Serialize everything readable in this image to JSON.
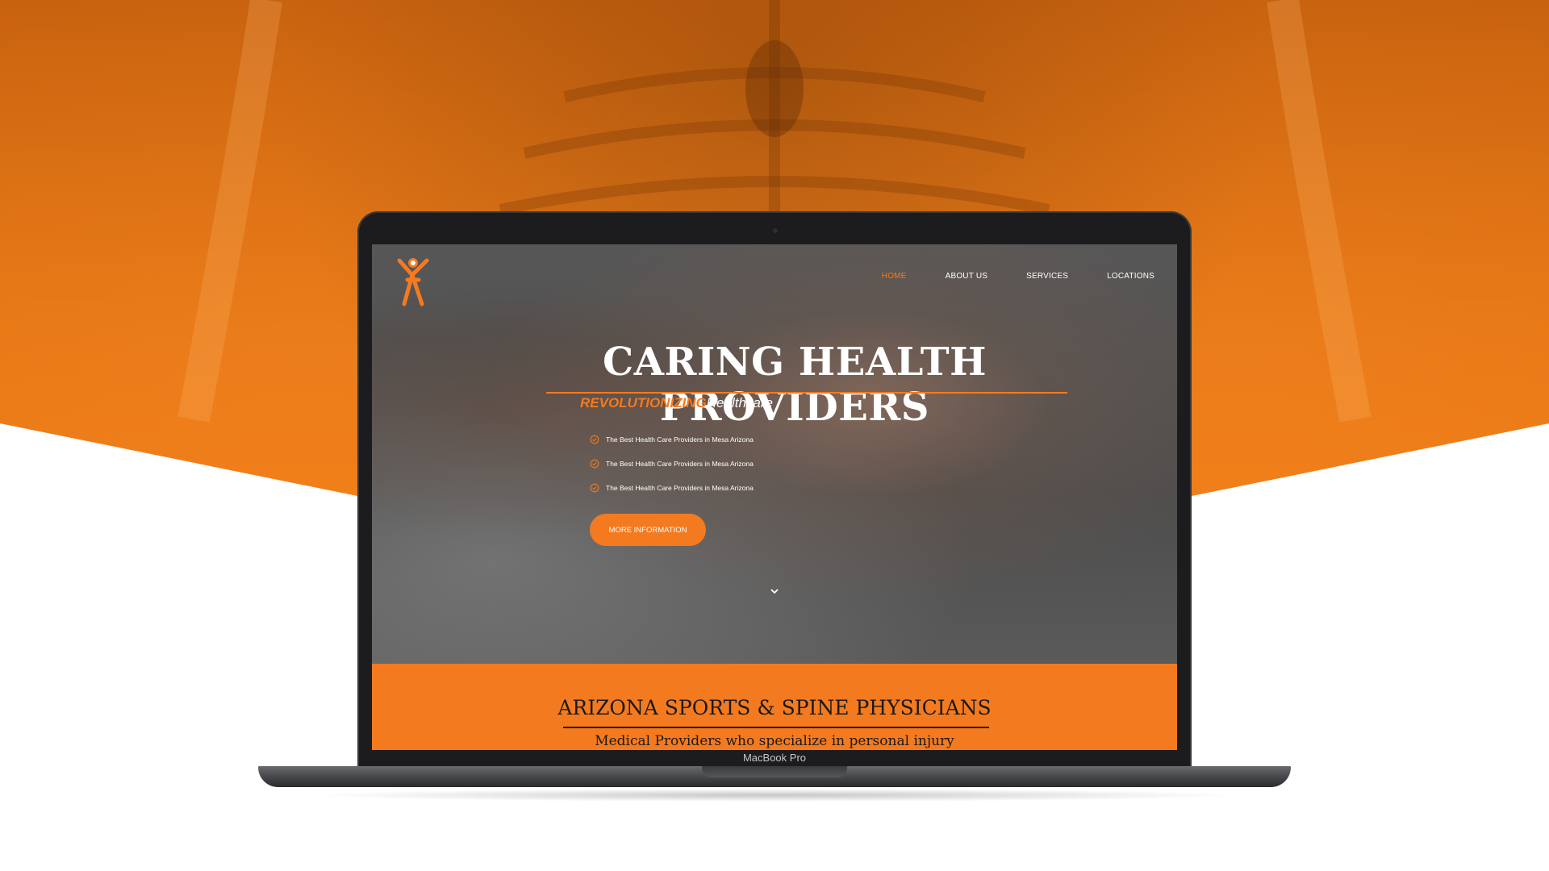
{
  "website": {
    "nav": {
      "items": [
        {
          "label": "HOME",
          "active": true
        },
        {
          "label": "ABOUT US",
          "active": false
        },
        {
          "label": "SERVICES",
          "active": false
        },
        {
          "label": "LOCATIONS",
          "active": false
        }
      ]
    },
    "hero": {
      "title": "CARING HEALTH PROVIDERS",
      "tagline_accent": "REVOLUTIONIZING",
      "tagline_rest": "Healthcare",
      "checklist": [
        "The Best Health Care Providers in Mesa Arizona",
        "The Best Health Care Providers in Mesa Arizona",
        "The Best Health Care Providers in Mesa Arizona"
      ],
      "cta_label": "MORE INFORMATION"
    },
    "section": {
      "title": "ARIZONA SPORTS & SPINE PHYSICIANS",
      "subtitle": "Medical Providers who specialize in personal injury"
    }
  },
  "device": {
    "label": "MacBook Pro"
  },
  "colors": {
    "brand_orange": "#f47a20",
    "background_orange": "#ef7a14",
    "dark_text": "#1a1a1a"
  },
  "icons": [
    "person-logo-icon",
    "check-circle-icon",
    "chevron-down-icon"
  ]
}
